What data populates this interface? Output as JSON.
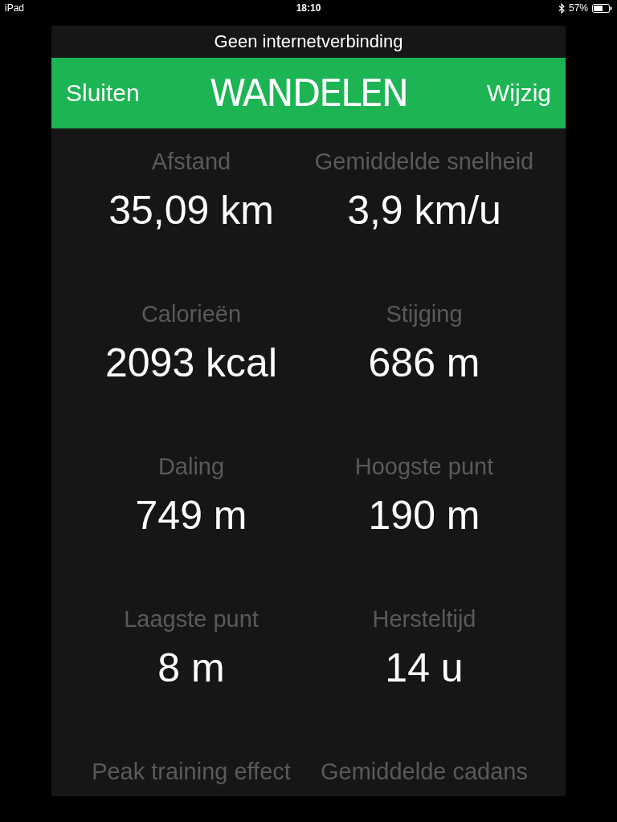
{
  "status_bar": {
    "device": "iPad",
    "time": "18:10",
    "battery_text": "57%"
  },
  "banner": {
    "text": "Geen internetverbinding"
  },
  "header": {
    "left": "Sluiten",
    "title": "WANDELEN",
    "right": "Wijzig"
  },
  "stats": [
    {
      "label": "Afstand",
      "value": "35,09 km"
    },
    {
      "label": "Gemiddelde snelheid",
      "value": "3,9 km/u"
    },
    {
      "label": "Calorieën",
      "value": "2093 kcal"
    },
    {
      "label": "Stijging",
      "value": "686 m"
    },
    {
      "label": "Daling",
      "value": "749 m"
    },
    {
      "label": "Hoogste punt",
      "value": "190 m"
    },
    {
      "label": "Laagste punt",
      "value": "8 m"
    },
    {
      "label": "Hersteltijd",
      "value": "14 u"
    },
    {
      "label": "Peak training effect"
    },
    {
      "label": "Gemiddelde cadans"
    }
  ]
}
